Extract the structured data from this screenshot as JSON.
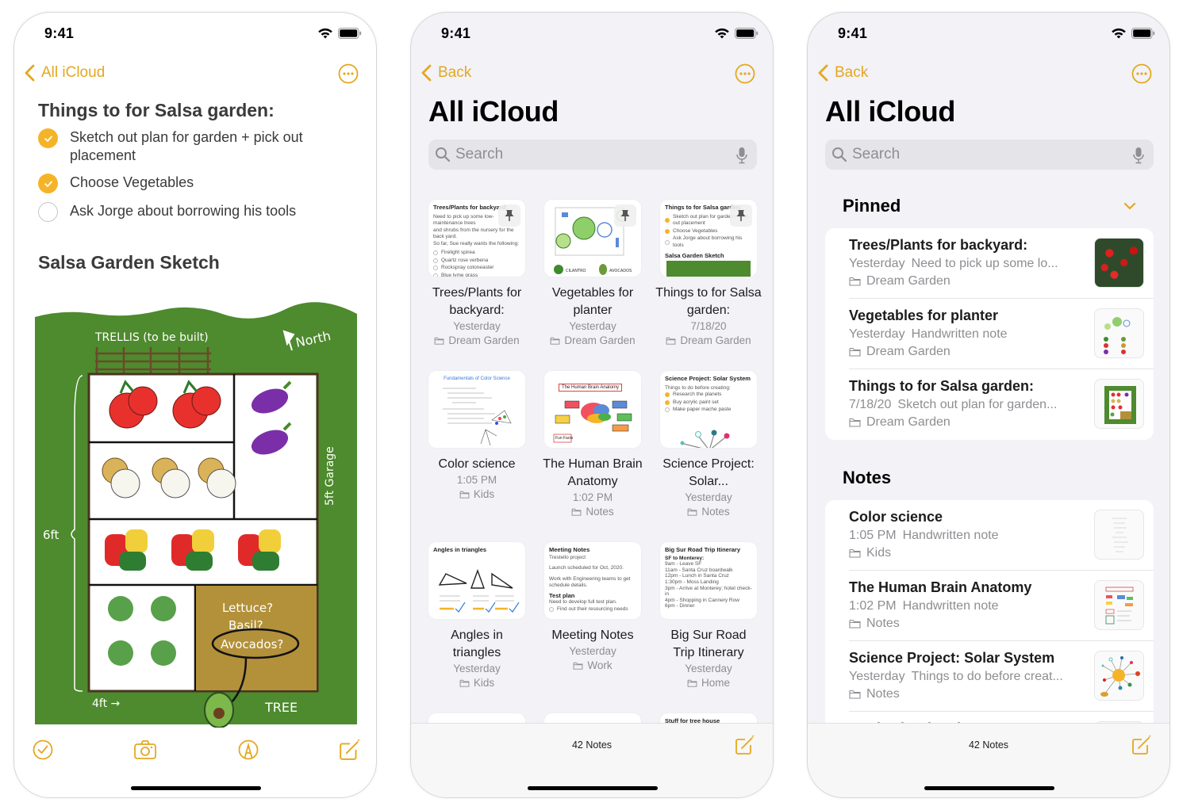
{
  "status_time": "9:41",
  "colors": {
    "accent": "#e4a820",
    "check_fill": "#f5b428",
    "grass": "#4e8a2e",
    "soil": "#b3913a"
  },
  "note_screen": {
    "back_label": "All iCloud",
    "title": "Things to for Salsa garden:",
    "checklist": [
      {
        "text": "Sketch out plan for garden + pick out placement",
        "checked": true
      },
      {
        "text": "Choose Vegetables",
        "checked": true
      },
      {
        "text": "Ask Jorge about borrowing his tools",
        "checked": false
      }
    ],
    "sketch_heading": "Salsa Garden Sketch",
    "sketch_labels": {
      "trellis": "TRELLIS (to be built)",
      "north": "North",
      "six_ft": "6ft",
      "four_ft": "4ft →",
      "five_ft_garage": "5ft Garage",
      "lettuce": "Lettuce?",
      "basil": "Basil?",
      "avocados": "Avocados?",
      "tree": "TREE"
    },
    "toolbar": [
      "checklist-icon",
      "camera-icon",
      "markup-icon",
      "compose-icon"
    ]
  },
  "gallery_screen": {
    "back_label": "Back",
    "title": "All iCloud",
    "search_placeholder": "Search",
    "notes": [
      {
        "title": "Trees/Plants for backyard:",
        "date": "Yesterday",
        "folder": "Dream Garden",
        "pinned": true,
        "preview": {
          "heading": "Trees/Plants for backyard:",
          "lines": [
            "Need to pick up some low-maintenance trees",
            "and shrubs from the nursery for the back yard.",
            "So far, Sue really wants the following:"
          ],
          "checks": [
            "Firelight spirea",
            "Quartz rose verbena",
            "Rockspray cotoneaster",
            "Blue lyme grass"
          ]
        }
      },
      {
        "title": "Vegetables for planter",
        "date": "Yesterday",
        "folder": "Dream Garden",
        "pinned": true,
        "preview": {
          "labels": [
            "CILANTRO",
            "AVOCADOS"
          ]
        }
      },
      {
        "title": "Things to for Salsa garden:",
        "date": "7/18/20",
        "folder": "Dream Garden",
        "pinned": true,
        "preview": {
          "heading": "Things to for Salsa garden:",
          "checks": [
            "Sketch out plan for garden + pick out placement",
            "Choose Vegetables",
            "Ask Jorge about borrowing his tools"
          ],
          "subheading": "Salsa Garden Sketch"
        }
      },
      {
        "title": "Color science",
        "date": "1:05 PM",
        "folder": "Kids",
        "pinned": false,
        "preview": {
          "heading": "Fundamentals of Color Science"
        }
      },
      {
        "title": "The Human Brain Anatomy",
        "date": "1:02 PM",
        "folder": "Notes",
        "pinned": false,
        "preview": {
          "heading": "The Human Brain Anatomy",
          "label": "Fun Facts"
        }
      },
      {
        "title": "Science Project: Solar...",
        "date": "Yesterday",
        "folder": "Notes",
        "pinned": false,
        "preview": {
          "heading": "Science Project: Solar System",
          "lines": [
            "Things to do before creating:"
          ],
          "checks": [
            "Research the planets",
            "Buy acrylic paint set",
            "Make paper mache paste"
          ]
        }
      },
      {
        "title": "Angles in triangles",
        "date": "Yesterday",
        "folder": "Kids",
        "pinned": false,
        "preview": {
          "heading": "Angles in triangles"
        }
      },
      {
        "title": "Meeting Notes",
        "date": "Yesterday",
        "folder": "Work",
        "pinned": false,
        "preview": {
          "heading": "Meeting Notes",
          "lines": [
            "Trestello project",
            "Launch scheduled for Oct, 2020.",
            "Work with Engineering teams to get schedule details."
          ],
          "subheading": "Test plan",
          "sublines": [
            "Need to develop full test plan."
          ],
          "checks": [
            "Find out their resourcing needs"
          ]
        }
      },
      {
        "title": "Big Sur Road Trip Itinerary",
        "date": "Yesterday",
        "folder": "Home",
        "pinned": false,
        "preview": {
          "heading": "Big Sur Road Trip Itinerary",
          "subheading": "SF to Monterey:",
          "lines": [
            "9am - Leave SF",
            "11am - Santa Cruz boardwalk",
            "12pm - Lunch in Santa Cruz",
            "1:30pm - Moss Landing",
            "3pm - Arrive at Monterey; hotel check-in",
            "4pm - Shopping in Cannery Row",
            "6pm - Dinner"
          ]
        }
      }
    ],
    "partial_row": {
      "third_heading": "Stuff for tree house"
    },
    "notes_count": "42 Notes"
  },
  "list_screen": {
    "back_label": "Back",
    "title": "All iCloud",
    "search_placeholder": "Search",
    "pinned_heading": "Pinned",
    "pinned": [
      {
        "title": "Trees/Plants for backyard:",
        "date": "Yesterday",
        "snippet": "Need to pick up some lo...",
        "folder": "Dream Garden"
      },
      {
        "title": "Vegetables for planter",
        "date": "Yesterday",
        "snippet": "Handwritten note",
        "folder": "Dream Garden"
      },
      {
        "title": "Things to for Salsa garden:",
        "date": "7/18/20",
        "snippet": "Sketch out plan for garden...",
        "folder": "Dream Garden"
      }
    ],
    "notes_heading": "Notes",
    "notes": [
      {
        "title": "Color science",
        "date": "1:05 PM",
        "snippet": "Handwritten note",
        "folder": "Kids"
      },
      {
        "title": "The Human Brain Anatomy",
        "date": "1:02 PM",
        "snippet": "Handwritten note",
        "folder": "Notes"
      },
      {
        "title": "Science Project: Solar System",
        "date": "Yesterday",
        "snippet": "Things to do before creat...",
        "folder": "Notes"
      }
    ],
    "partial_title": "Angles in triangles",
    "notes_count": "42 Notes"
  }
}
